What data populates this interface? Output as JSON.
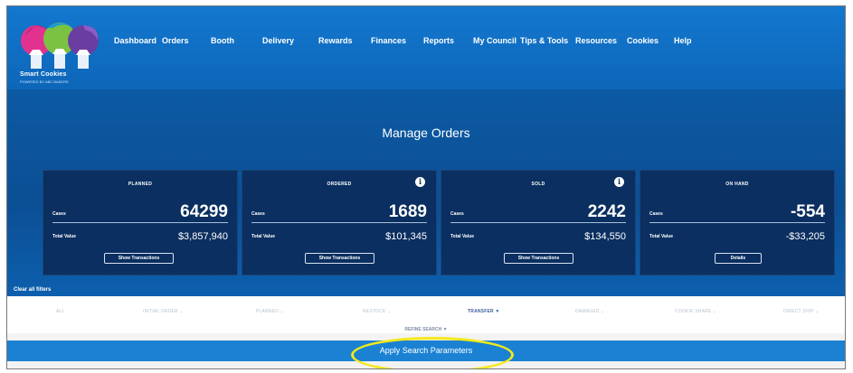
{
  "brand": {
    "name": "Smart Cookies",
    "tagline": "POWERED BY ABC BAKERS",
    "colors": {
      "header": "#1378cf",
      "banner": "#0b4f94",
      "card": "#0a2f60",
      "apply": "#1b82d3",
      "highlight": "#f4e91b"
    }
  },
  "nav": {
    "items": [
      "Dashboard",
      "Orders",
      "Booth",
      "Delivery",
      "Rewards",
      "Finances",
      "Reports",
      "My Council",
      "Tips & Tools",
      "Resources",
      "Cookies",
      "Help"
    ]
  },
  "page": {
    "title": "Manage Orders"
  },
  "cards": [
    {
      "label": "PLANNED",
      "cases_label": "Cases",
      "cases": "64299",
      "value_label": "Total Value",
      "value": "$3,857,940",
      "button": "Show Transactions",
      "info_icon": false
    },
    {
      "label": "ORDERED",
      "cases_label": "Cases",
      "cases": "1689",
      "value_label": "Total Value",
      "value": "$101,345",
      "button": "Show Transactions",
      "info_icon": true
    },
    {
      "label": "SOLD",
      "cases_label": "Cases",
      "cases": "2242",
      "value_label": "Total Value",
      "value": "$134,550",
      "button": "Show Transactions",
      "info_icon": true
    },
    {
      "label": "ON HAND",
      "cases_label": "Cases",
      "cases": "-554",
      "value_label": "Total Value",
      "value": "-$33,205",
      "button": "Details",
      "info_icon": false
    }
  ],
  "clear_filters": "Clear all filters",
  "filters": [
    {
      "label": "ALL",
      "active": false
    },
    {
      "label": "INITIAL ORDER ⌄",
      "active": false
    },
    {
      "label": "PLANNED ⌄",
      "active": false
    },
    {
      "label": "RESTOCK ⌄",
      "active": false
    },
    {
      "label": "TRANSFER ▼",
      "active": true
    },
    {
      "label": "DAMAGED ⌄",
      "active": false
    },
    {
      "label": "COOKIE SHARE ⌄",
      "active": false
    },
    {
      "label": "DIRECT SHIP ⌄",
      "active": false
    }
  ],
  "refine": "REFINE SEARCH ▼",
  "apply": "Apply Search Parameters"
}
